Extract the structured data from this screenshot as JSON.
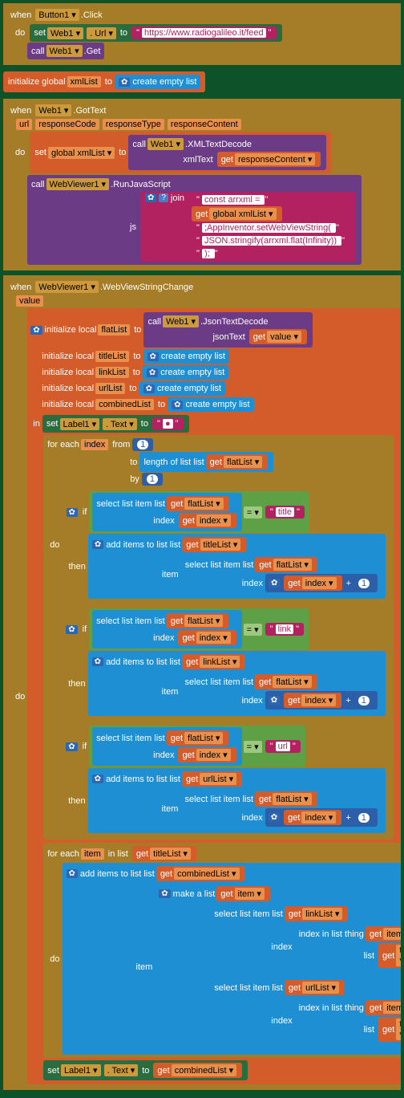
{
  "blk1": {
    "when": "when",
    "comp": "Button1 ▾",
    "evt": ".Click",
    "do": "do",
    "set": "set",
    "web": "Web1 ▾",
    "urlProp": ". Url ▾",
    "to": "to",
    "urlVal": "https://www.radiogalileo.it/feed",
    "call": "call",
    "getMeth": ".Get"
  },
  "blk2": {
    "init": "initialize global",
    "name": "xmlList",
    "to": "to",
    "gear": "✿",
    "create": "create empty list"
  },
  "blk3": {
    "when": "when",
    "comp": "Web1 ▾",
    "evt": ".GotText",
    "p1": "url",
    "p2": "responseCode",
    "p3": "responseType",
    "p4": "responseContent",
    "do": "do",
    "setG": "set",
    "gvar": "global xmlList ▾",
    "to": "to",
    "call": "call",
    "web": "Web1 ▾",
    "decode": ".XMLTextDecode",
    "xmlText": "xmlText",
    "get": "get",
    "rc": "responseContent ▾",
    "wv": "WebViewer1 ▾",
    "runjs": ".RunJavaScript",
    "js": "js",
    "gear": "✿",
    "help": "?",
    "join": "join",
    "j1": "const arrxml = ",
    "j2": "global xmlList ▾",
    "j3": ";AppInventor.setWebViewString( ",
    "j4": "JSON.stringify(arrxml.flat(Infinity)) ",
    "j5": " ); "
  },
  "blk4": {
    "when": "when",
    "comp": "WebViewer1 ▾",
    "evt": ".WebViewStringChange",
    "val": "value",
    "do": "do",
    "gear": "✿",
    "initLocal": "initialize local",
    "flat": "flatList",
    "to": "to",
    "call": "call",
    "web": "Web1 ▾",
    "jsond": ".JsonTextDecode",
    "jsonText": "jsonText",
    "get": "get",
    "valueV": "value ▾",
    "title": "titleList",
    "link": "linkList",
    "url": "urlList",
    "comb": "combinedList",
    "create": "create empty list",
    "inKw": "in",
    "set": "set",
    "label": "Label1 ▾",
    "textP": ". Text ▾",
    "bullet": "●",
    "foreach": "for each",
    "index": "index",
    "from": "from",
    "toK": "to",
    "by": "by",
    "one": "1",
    "len": "length of list  list",
    "flatV": "flatList ▾",
    "doK": "do",
    "if": "if",
    "then": "then",
    "sel": "select list item  list",
    "idx": "index",
    "idxV": "index ▾",
    "eq": "= ▾",
    "titleS": "title",
    "linkS": "link",
    "urlS": "url",
    "add": "add items to list  list",
    "item": "item",
    "plus": "+",
    "oneN": "1",
    "titleLV": "titleList ▾",
    "linkLV": "linkList ▾",
    "urlLV": "urlList ▾",
    "combLV": "combinedList ▾",
    "forItem": "for each",
    "itemK": "item",
    "inList": "in list",
    "make": "make a list",
    "itemV": "item ▾",
    "idxin": "index in list  thing",
    "listK": "list"
  }
}
